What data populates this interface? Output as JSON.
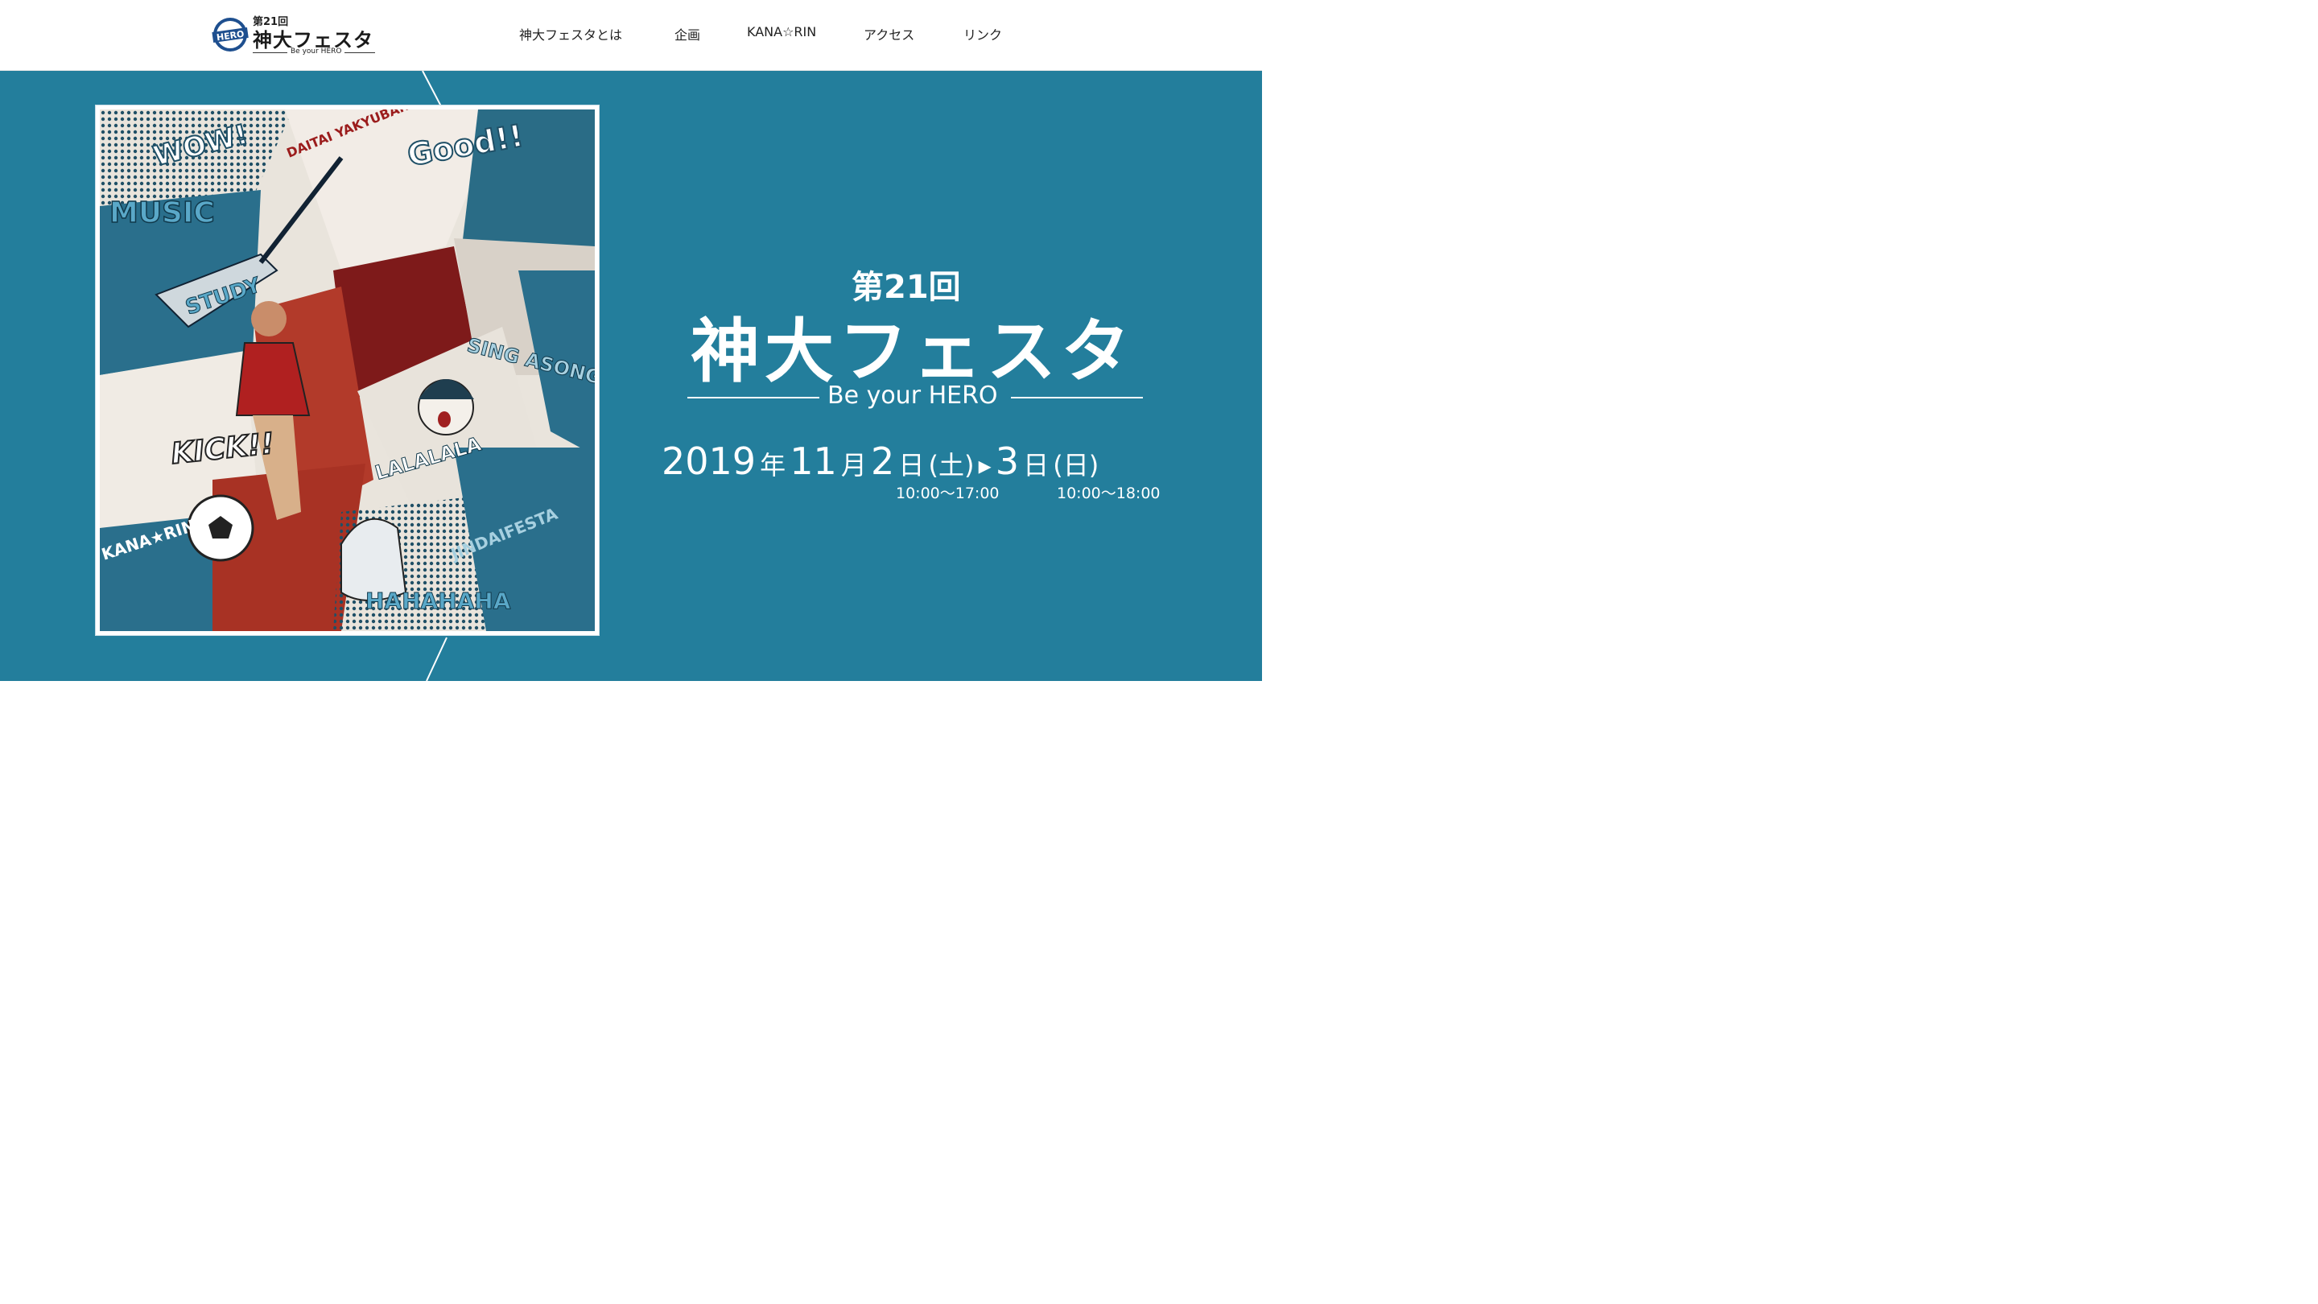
{
  "header": {
    "logo": {
      "badge_text": "HERO",
      "edition": "第21回",
      "title": "神大フェスタ",
      "tagline": "Be your HERO"
    },
    "nav": [
      {
        "label": "神大フェスタとは"
      },
      {
        "label": "企画"
      },
      {
        "label": "KANA☆RIN"
      },
      {
        "label": "アクセス"
      },
      {
        "label": "リンク"
      }
    ]
  },
  "hero": {
    "edition": "第21回",
    "title": "神大フェスタ",
    "tagline": "Be your HERO",
    "date": {
      "year": "2019",
      "year_unit": "年",
      "month": "11",
      "month_unit": "月",
      "day1": "2",
      "day_unit": "日",
      "weekday1": "(土)",
      "arrow": "▸",
      "day2": "3",
      "weekday2": "(日)",
      "time1": "10:00～17:00",
      "time2": "10:00～18:00"
    },
    "poster": {
      "words": [
        "WOW!",
        "Good!!",
        "MUSIC",
        "STUDY",
        "KICK!!",
        "SING ASONG",
        "LALALALA",
        "HAHAHAHA",
        "DAITAI YAKYUBAN",
        "KANA★RIN",
        "JINDAIFESTA"
      ]
    }
  },
  "colors": {
    "hero_bg": "#237e9c",
    "poster_blue": "#1f6f8c",
    "poster_red": "#9b1c1c",
    "text_light": "#ffffff",
    "nav_text": "#222222"
  }
}
